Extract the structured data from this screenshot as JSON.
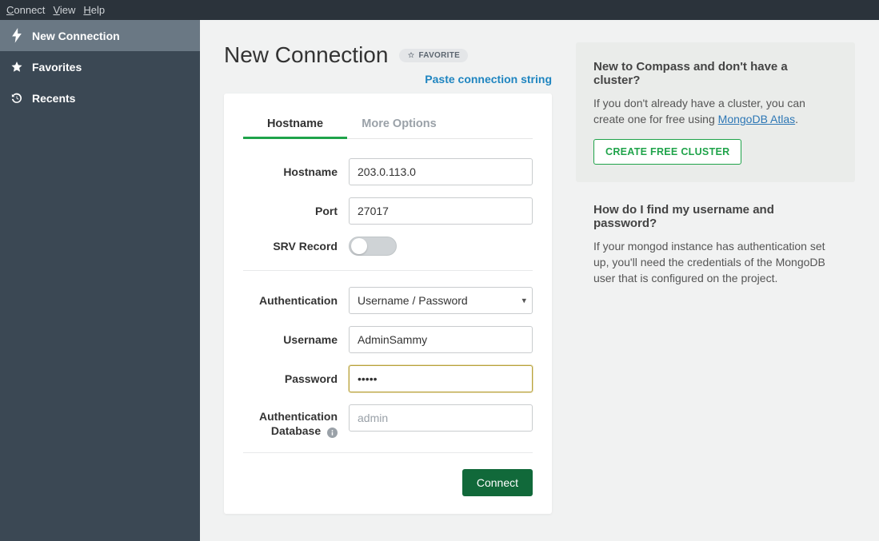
{
  "menubar": {
    "connect": "onnect",
    "connect_u": "C",
    "view": "iew",
    "view_u": "V",
    "help": "elp",
    "help_u": "H"
  },
  "sidebar": {
    "items": [
      {
        "label": "New Connection"
      },
      {
        "label": "Favorites"
      },
      {
        "label": "Recents"
      }
    ]
  },
  "header": {
    "title": "New Connection",
    "favorite_label": "FAVORITE",
    "paste_link": "Paste connection string"
  },
  "tabs": {
    "hostname": "Hostname",
    "more": "More Options"
  },
  "form": {
    "hostname_label": "Hostname",
    "hostname_value": "203.0.113.0",
    "port_label": "Port",
    "port_value": "27017",
    "srv_label": "SRV Record",
    "auth_label": "Authentication",
    "auth_selected": "Username / Password",
    "username_label": "Username",
    "username_value": "AdminSammy",
    "password_label": "Password",
    "password_value": "•••••",
    "authdb_label": "Authentication Database",
    "authdb_placeholder": "admin",
    "connect_button": "Connect"
  },
  "rightpanel": {
    "cluster_title": "New to Compass and don't have a cluster?",
    "cluster_text_pre": "If you don't already have a cluster, you can create one for free using ",
    "cluster_link": "MongoDB Atlas",
    "cluster_text_post": ".",
    "cluster_button": "CREATE FREE CLUSTER",
    "creds_title": "How do I find my username and password?",
    "creds_text": "If your mongod instance has authentication set up, you'll need the credentials of the MongoDB user that is configured on the project."
  }
}
